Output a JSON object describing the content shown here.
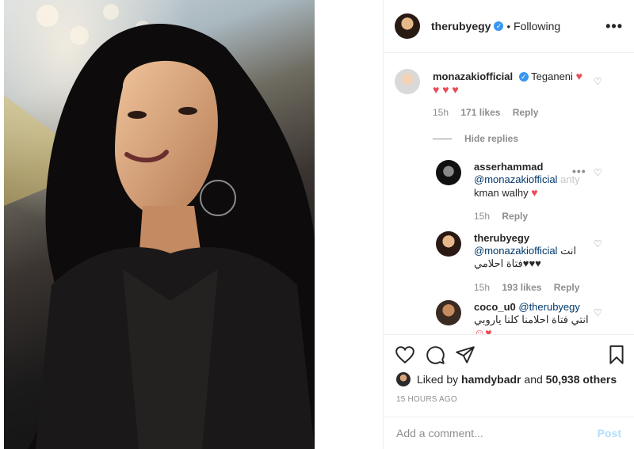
{
  "header": {
    "username": "therubyegy",
    "separator": "•",
    "follow_status": "Following",
    "more": "•••"
  },
  "comments": [
    {
      "username": "monazakiofficial",
      "text": "Teganeni",
      "hearts": "♥ ♥ ♥",
      "time": "15h",
      "likes": "171 likes",
      "reply": "Reply"
    }
  ],
  "hide_replies": "Hide replies",
  "replies": [
    {
      "username": "asserhammad",
      "mention": "@monazakiofficial",
      "text_line1_end": "anty",
      "text_line2": "kman walhy",
      "time": "15h",
      "reply": "Reply"
    },
    {
      "username": "therubyegy",
      "mention": "@monazakiofficial",
      "text_line1_end": "انت",
      "text_line2": "فتاة احلامي♥♥♥",
      "time": "15h",
      "likes": "193 likes",
      "reply": "Reply"
    },
    {
      "username": "coco_u0",
      "mention": "@therubyegy",
      "text_line2": "انتي فتاة احلامنا كلنا ياروبي"
    }
  ],
  "likes": {
    "prefix": "Liked by",
    "user": "hamdybadr",
    "and": "and",
    "others": "50,938 others"
  },
  "timestamp": "15 HOURS AGO",
  "add_comment": {
    "placeholder": "Add a comment...",
    "post_label": "Post"
  },
  "colors": {
    "verified": "#3897f0",
    "red_heart": "#ed4956",
    "post_disabled": "#b2dffc",
    "muted": "#8e8e8e"
  },
  "icons": [
    "heart-icon",
    "comment-icon",
    "share-icon",
    "bookmark-icon",
    "verified-icon",
    "like-heart-icon"
  ]
}
